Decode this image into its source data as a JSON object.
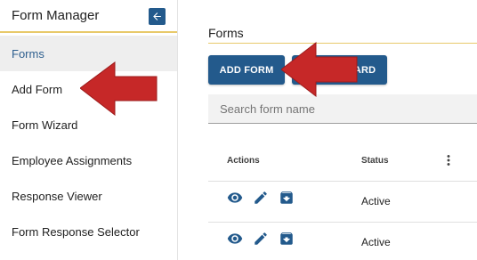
{
  "sidebar": {
    "title": "Form Manager",
    "items": [
      {
        "label": "Forms",
        "active": true
      },
      {
        "label": "Add Form",
        "active": false
      },
      {
        "label": "Form Wizard",
        "active": false
      },
      {
        "label": "Employee Assignments",
        "active": false
      },
      {
        "label": "Response Viewer",
        "active": false
      },
      {
        "label": "Form Response Selector",
        "active": false
      }
    ]
  },
  "main": {
    "title": "Forms",
    "add_form_label": "ADD FORM",
    "form_wizard_label": "FORM WIZARD",
    "search_placeholder": "Search form name",
    "table": {
      "columns": [
        "Actions",
        "Status"
      ],
      "rows": [
        {
          "status": "Active",
          "actions": [
            "eye-icon",
            "pencil-icon",
            "archive-icon"
          ]
        },
        {
          "status": "Active",
          "actions": [
            "eye-icon",
            "pencil-icon",
            "archive-icon"
          ]
        }
      ]
    }
  },
  "colors": {
    "primary": "#235a8c",
    "accent_line": "#e8c96a",
    "annotation_arrow": "#c62828"
  }
}
